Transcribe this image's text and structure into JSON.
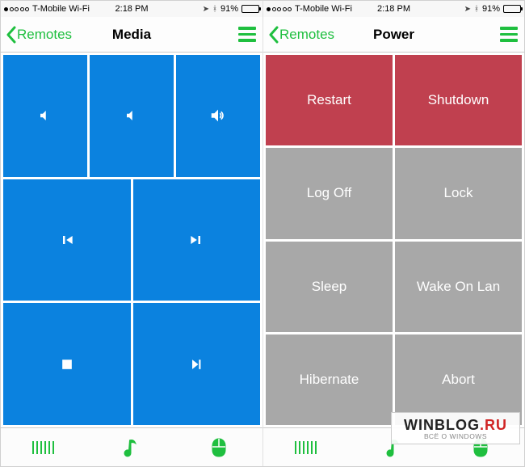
{
  "statusbar": {
    "carrier": "T-Mobile Wi-Fi",
    "time": "2:18 PM",
    "battery_pct": "91%"
  },
  "screens": {
    "left": {
      "back_label": "Remotes",
      "title": "Media",
      "tiles": {
        "vol_down": "volume-down-icon",
        "mute": "mute-icon",
        "vol_up": "volume-up-icon",
        "prev": "previous-track-icon",
        "next": "next-track-icon",
        "stop": "stop-icon",
        "play": "play-step-icon"
      }
    },
    "right": {
      "back_label": "Remotes",
      "title": "Power",
      "buttons": [
        [
          "Restart",
          "Shutdown"
        ],
        [
          "Log Off",
          "Lock"
        ],
        [
          "Sleep",
          "Wake On Lan"
        ],
        [
          "Hibernate",
          "Abort"
        ]
      ],
      "danger_rows": [
        0
      ]
    }
  },
  "toolbar": {
    "items": [
      "keyboard-icon",
      "music-icon",
      "mouse-icon"
    ]
  },
  "watermark": {
    "brand_a": "WINBLOG",
    "brand_b": ".RU",
    "tagline": "ВСЁ О WINDOWS"
  },
  "colors": {
    "accent": "#1fbf3f",
    "media_tile": "#0b82df",
    "power_tile": "#a8a8a8",
    "power_danger": "#c0404f"
  }
}
